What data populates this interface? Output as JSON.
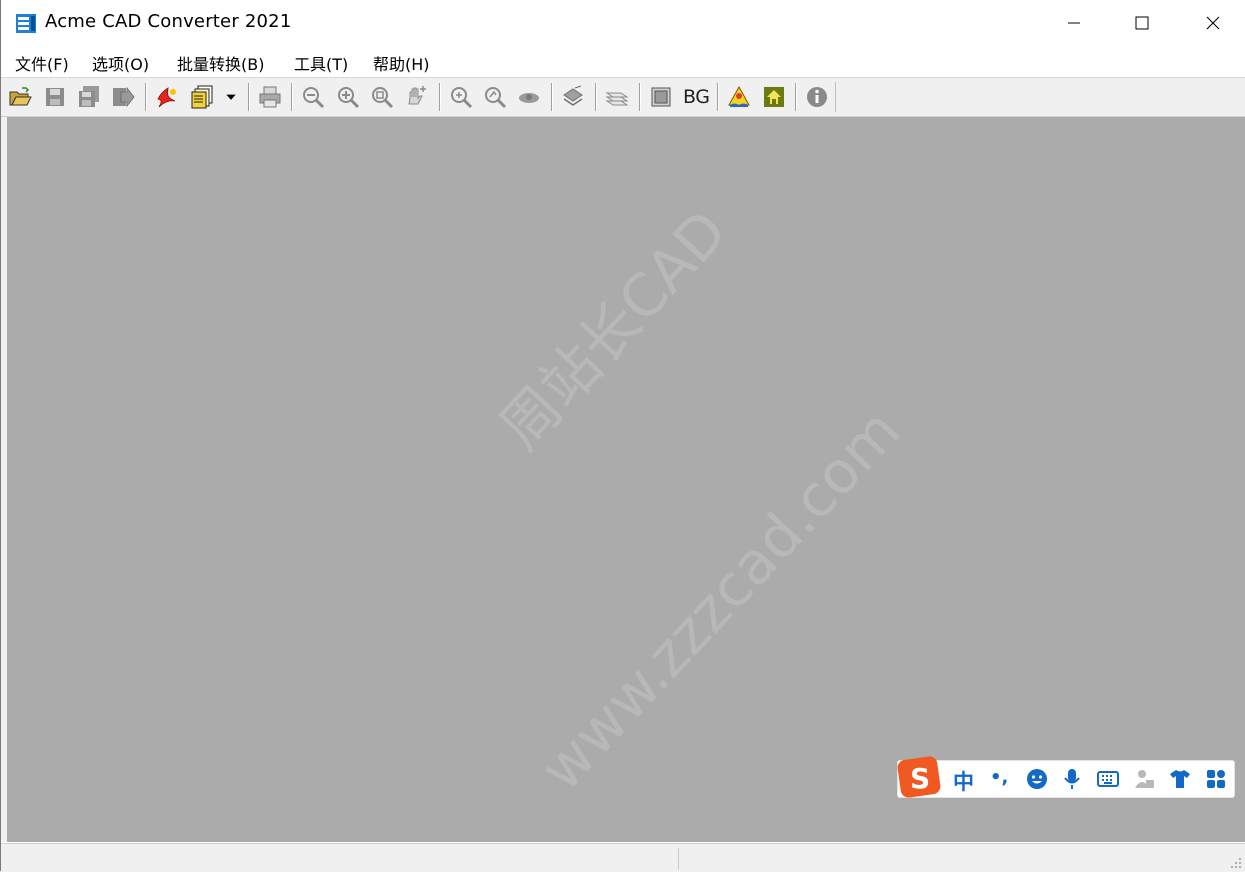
{
  "window": {
    "title": "Acme CAD Converter 2021"
  },
  "menu": [
    {
      "label": "文件(F)"
    },
    {
      "label": "选项(O)"
    },
    {
      "label": "批量转换(B)"
    },
    {
      "label": "工具(T)"
    },
    {
      "label": "帮助(H)"
    }
  ],
  "toolbar": {
    "bg_label": "BG"
  },
  "watermark": {
    "line1": "周站长CAD",
    "line2": "www.zzzcad.com"
  },
  "ime": {
    "mode": "中",
    "punct": "•,"
  },
  "colors": {
    "workspace": "#ababab",
    "chrome": "#f0f0f0",
    "ime_blue": "#1468c8",
    "ime_logo": "#f05a22"
  }
}
